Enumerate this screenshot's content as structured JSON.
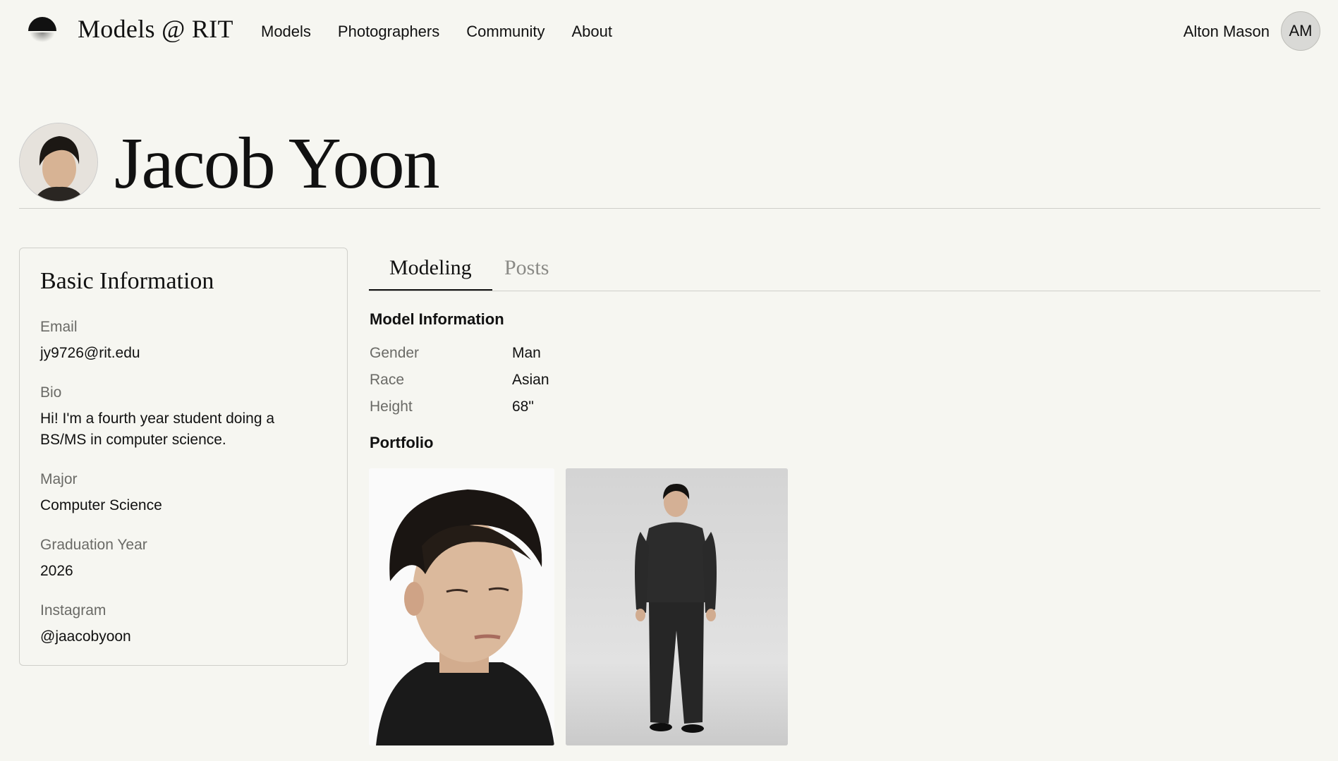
{
  "app": {
    "brand": "Models @ RIT",
    "nav": [
      {
        "label": "Models"
      },
      {
        "label": "Photographers"
      },
      {
        "label": "Community"
      },
      {
        "label": "About"
      }
    ],
    "user": {
      "name": "Alton Mason",
      "initials": "AM"
    }
  },
  "profile": {
    "name": "Jacob Yoon"
  },
  "basic_info": {
    "title": "Basic Information",
    "fields": [
      {
        "label": "Email",
        "value": "jy9726@rit.edu"
      },
      {
        "label": "Bio",
        "value": "Hi! I'm a fourth year student doing a BS/MS in computer science."
      },
      {
        "label": "Major",
        "value": "Computer Science"
      },
      {
        "label": "Graduation Year",
        "value": "2026"
      },
      {
        "label": "Instagram",
        "value": "@jaacobyoon"
      }
    ]
  },
  "tabs": [
    {
      "label": "Modeling",
      "active": true
    },
    {
      "label": "Posts",
      "active": false
    }
  ],
  "model_info": {
    "title": "Model Information",
    "rows": [
      {
        "label": "Gender",
        "value": "Man"
      },
      {
        "label": "Race",
        "value": "Asian"
      },
      {
        "label": "Height",
        "value": "68\""
      }
    ]
  },
  "portfolio": {
    "title": "Portfolio"
  }
}
